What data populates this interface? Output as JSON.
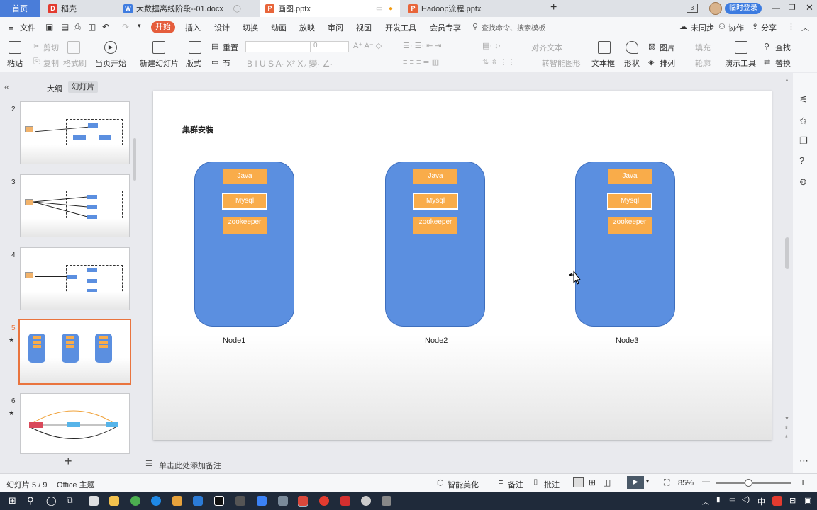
{
  "tabs": {
    "home": "首页",
    "daoke": "稻壳",
    "docx": "大数据离线阶段--01.docx",
    "pptx_active": "画图.pptx",
    "pptx_other": "Hadoop流程.pptx",
    "login": "临时登录"
  },
  "menu": {
    "file": "文件",
    "start": "开始",
    "insert": "插入",
    "design": "设计",
    "switch": "切换",
    "animation": "动画",
    "show": "放映",
    "review": "审阅",
    "view": "视图",
    "devtools": "开发工具",
    "member": "会员专享",
    "search_placeholder": "查找命令、搜索模板",
    "unsynced": "未同步",
    "collab": "协作",
    "share": "分享"
  },
  "ribbon": {
    "paste": "粘贴",
    "cut": "剪切",
    "copy": "复制",
    "format_painter": "格式刷",
    "play_current": "当页开始",
    "new_slide": "新建幻灯片",
    "layout": "版式",
    "section": "节",
    "reset": "重置",
    "font_size": "0",
    "align_text": "对齐文本",
    "convert_shape": "转智能图形",
    "textbox": "文本框",
    "shape": "形状",
    "picture": "图片",
    "arrange": "排列",
    "fill": "填充",
    "outline": "轮廓",
    "presentation_tools": "演示工具",
    "find": "查找",
    "replace": "替换"
  },
  "panel": {
    "outline_tab": "大纲",
    "slides_tab": "幻灯片",
    "slide_numbers": [
      "2",
      "3",
      "4",
      "5",
      "6"
    ],
    "add_slide": "+"
  },
  "slide": {
    "title": "集群安装",
    "nodes": [
      {
        "name": "Node1",
        "items": [
          "Java",
          "Mysql",
          "zookeeper"
        ]
      },
      {
        "name": "Node2",
        "items": [
          "Java",
          "Mysql",
          "zookeeper"
        ]
      },
      {
        "name": "Node3",
        "items": [
          "Java",
          "Mysql",
          "zookeeper"
        ]
      }
    ]
  },
  "notes": {
    "placeholder": "单击此处添加备注"
  },
  "status": {
    "slide_index": "幻灯片 5 / 9",
    "theme": "Office 主题",
    "smart_beautify": "智能美化",
    "notes": "备注",
    "comments": "批注",
    "zoom": "85%"
  },
  "colors": {
    "node_fill": "#5b8fe0",
    "box_fill": "#f9ac4a",
    "accent": "#e55d3c",
    "selection": "#e9743e"
  }
}
